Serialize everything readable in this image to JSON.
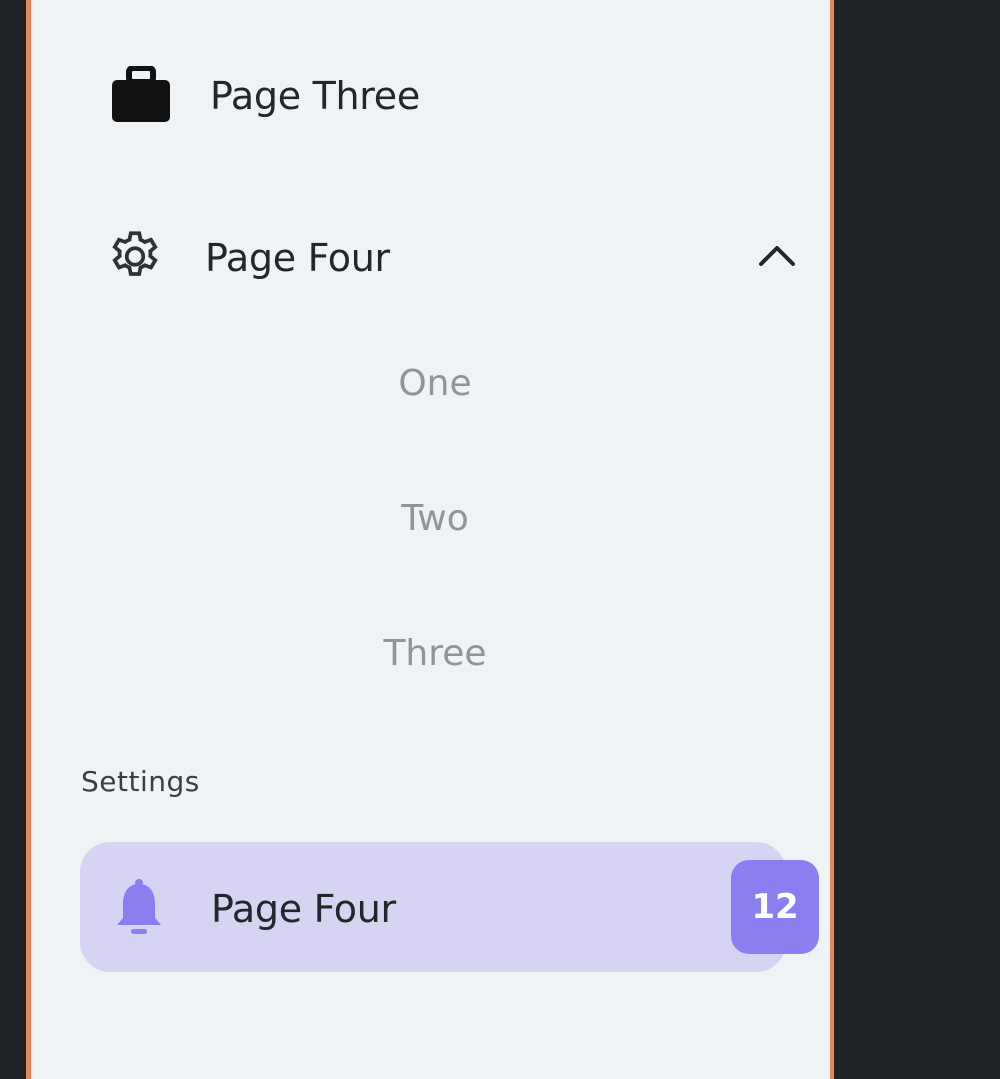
{
  "nav": {
    "page_three": {
      "label": "Page Three",
      "icon": "briefcase-icon"
    },
    "page_four": {
      "label": "Page Four",
      "icon": "gear-icon",
      "expanded": true,
      "children": [
        {
          "label": "One"
        },
        {
          "label": "Two"
        },
        {
          "label": "Three"
        }
      ]
    }
  },
  "settings": {
    "title": "Settings",
    "active_item": {
      "label": "Page Four",
      "icon": "bell-icon",
      "badge": "12"
    }
  },
  "colors": {
    "panel_bg": "#eff3f6",
    "border_accent": "#e8855a",
    "active_bg": "#d6d3f3",
    "badge_bg": "#8b7ef0",
    "dark_bg": "#1e2427"
  }
}
